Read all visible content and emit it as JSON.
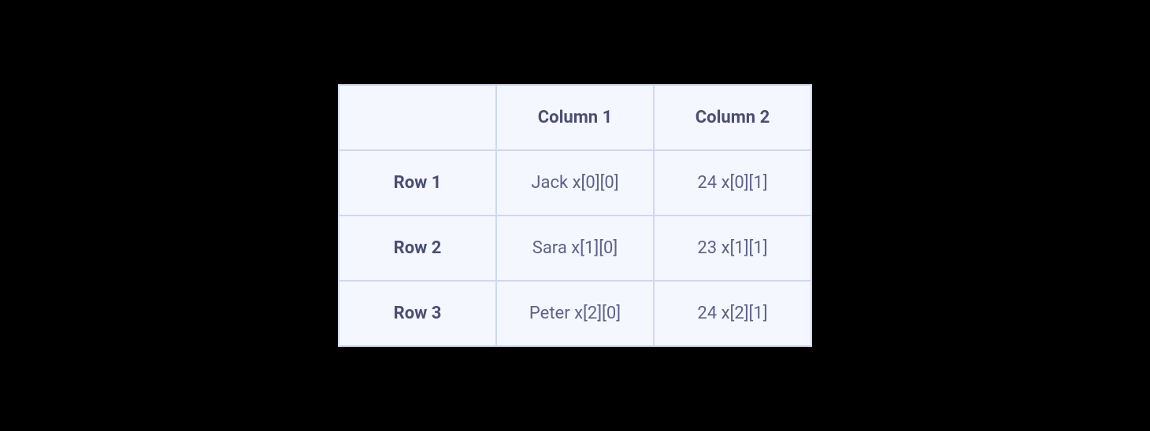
{
  "table": {
    "columns": [
      "Column 1",
      "Column 2"
    ],
    "rows": [
      {
        "label": "Row 1",
        "cells": [
          "Jack x[0][0]",
          "24 x[0][1]"
        ]
      },
      {
        "label": "Row 2",
        "cells": [
          "Sara x[1][0]",
          "23 x[1][1]"
        ]
      },
      {
        "label": "Row 3",
        "cells": [
          "Peter x[2][0]",
          "24 x[2][1]"
        ]
      }
    ]
  }
}
